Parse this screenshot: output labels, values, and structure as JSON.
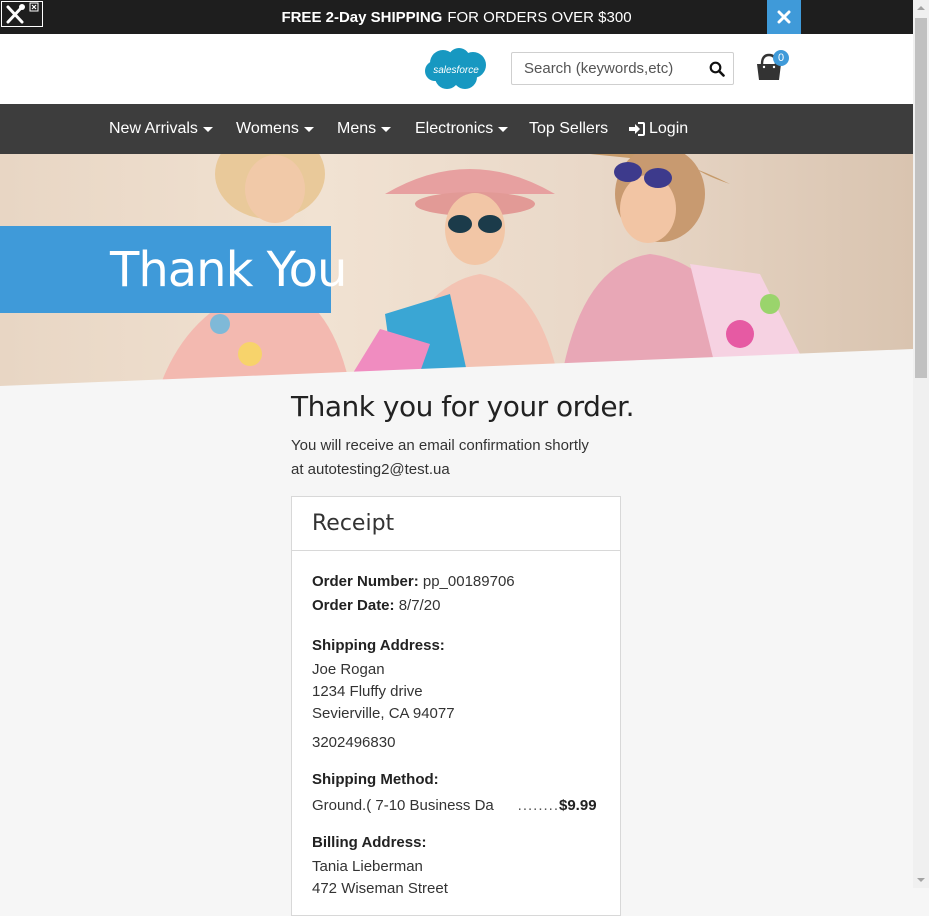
{
  "promo": {
    "bold_text": "FREE 2-Day SHIPPING",
    "text": "FOR ORDERS OVER $300"
  },
  "header": {
    "logo_text": "salesforce",
    "search_placeholder": "Search (keywords,etc)",
    "cart_count": "0"
  },
  "nav": {
    "items": [
      {
        "label": "New Arrivals",
        "dropdown": true
      },
      {
        "label": "Womens",
        "dropdown": true
      },
      {
        "label": "Mens",
        "dropdown": true
      },
      {
        "label": "Electronics",
        "dropdown": true
      },
      {
        "label": "Top Sellers",
        "dropdown": false
      }
    ],
    "login_label": "Login"
  },
  "hero": {
    "title": "Thank You"
  },
  "main": {
    "heading": "Thank you for your order.",
    "confirm_line1": "You will receive an email confirmation shortly",
    "confirm_line2": "at autotesting2@test.ua"
  },
  "receipt": {
    "title": "Receipt",
    "order_number_label": "Order Number:",
    "order_number": "pp_00189706",
    "order_date_label": "Order Date:",
    "order_date": "8/7/20",
    "shipping_address_label": "Shipping Address:",
    "shipping_name": "Joe Rogan",
    "shipping_street": "1234 Fluffy drive",
    "shipping_city": "Sevierville, CA 94077",
    "shipping_phone": "3202496830",
    "shipping_method_label": "Shipping Method:",
    "shipping_method": "Ground.( 7-10 Business Da",
    "shipping_dots": "........",
    "shipping_price": "$9.99",
    "billing_address_label": "Billing Address:",
    "billing_name": "Tania Lieberman",
    "billing_street": "472 Wiseman Street"
  },
  "colors": {
    "accent": "#3f9ad9",
    "nav_bg": "#3d3d3d",
    "promo_bg": "#1e1e1e"
  }
}
